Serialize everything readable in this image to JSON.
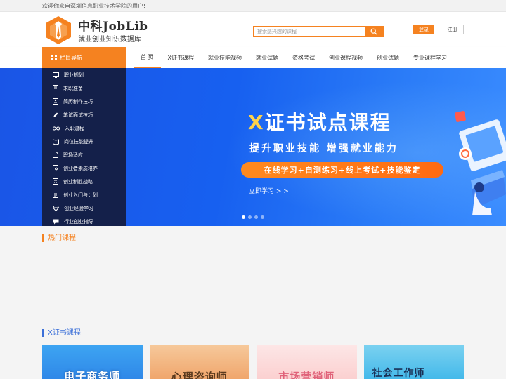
{
  "topbar": {
    "welcome": "欢迎你来自深圳信息职业技术学院的用户!"
  },
  "brand": {
    "title": "中科JobLib",
    "subtitle": "就业创业知识数据库"
  },
  "search": {
    "placeholder": "搜索感兴趣的课程"
  },
  "auth": {
    "login": "登录",
    "register": "注册"
  },
  "nav": {
    "category_label": "栏目导航",
    "links": [
      {
        "label": "首 页",
        "active": true
      },
      {
        "label": "X证书课程"
      },
      {
        "label": "就业技能视频"
      },
      {
        "label": "就业试题"
      },
      {
        "label": "资格考试"
      },
      {
        "label": "创业课程视频"
      },
      {
        "label": "创业试题"
      },
      {
        "label": "专业课程学习"
      }
    ]
  },
  "sidebar": {
    "items": [
      {
        "label": "职业规划",
        "icon": "monitor-icon"
      },
      {
        "label": "求职准备",
        "icon": "document-icon"
      },
      {
        "label": "简历制作技巧",
        "icon": "resume-icon"
      },
      {
        "label": "笔试面试技巧",
        "icon": "pen-icon"
      },
      {
        "label": "入职流程",
        "icon": "infinity-icon"
      },
      {
        "label": "岗位技能提升",
        "icon": "book-icon"
      },
      {
        "label": "职场适应",
        "icon": "page-icon"
      },
      {
        "label": "创业者素质培养",
        "icon": "certificate-icon"
      },
      {
        "label": "创业制胜战略",
        "icon": "calculator-icon"
      },
      {
        "label": "创业入门与计划",
        "icon": "list-icon"
      },
      {
        "label": "创业经验学习",
        "icon": "diamond-icon"
      },
      {
        "label": "行业创业指导",
        "icon": "chat-icon"
      }
    ]
  },
  "banner": {
    "title_x": "X",
    "title_rest": "证书试点课程",
    "subtitle": "提升职业技能  增强就业能力",
    "pill": "在线学习+自测练习+线上考试+技能鉴定",
    "link": "立即学习 > >",
    "slide_count": 4,
    "active_slide": 1
  },
  "sections": {
    "hot": "热门课程",
    "xcert": "X证书课程"
  },
  "cards": [
    {
      "label": "电子商务师"
    },
    {
      "label": "心理咨询师"
    },
    {
      "label": "市场营销师"
    },
    {
      "label": "社会工作师"
    }
  ],
  "colors": {
    "accent": "#f58220",
    "sidebar": "#14204a",
    "banner": "#1760f0",
    "section_blue": "#3b6fd8"
  }
}
